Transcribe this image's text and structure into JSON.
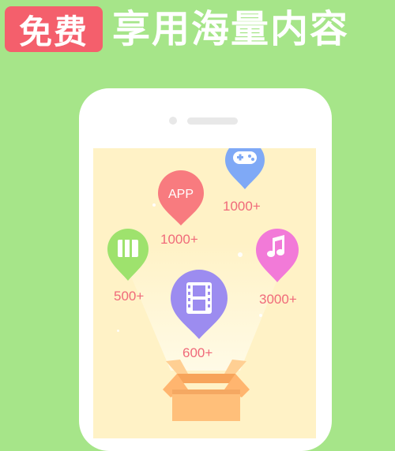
{
  "banner": {
    "badge": "免费",
    "tagline": "享用海量内容"
  },
  "categories": [
    {
      "key": "app",
      "label": "APP",
      "count": "1000+",
      "color": "#f87b7f"
    },
    {
      "key": "games",
      "icon": "gamepad-icon",
      "count": "1000+",
      "color": "#7fa9f6"
    },
    {
      "key": "books",
      "icon": "book-icon",
      "count": "500+",
      "color": "#9ee26d"
    },
    {
      "key": "music",
      "icon": "music-note-icon",
      "count": "3000+",
      "color": "#f27ad8"
    },
    {
      "key": "videos",
      "icon": "film-icon",
      "count": "600+",
      "color": "#9c8cf0"
    }
  ],
  "colors": {
    "background": "#a6e589",
    "badge": "#f45f6c",
    "screen": "#fff2c6",
    "count_text": "#f06a7a",
    "box": "#ffbf7a"
  }
}
